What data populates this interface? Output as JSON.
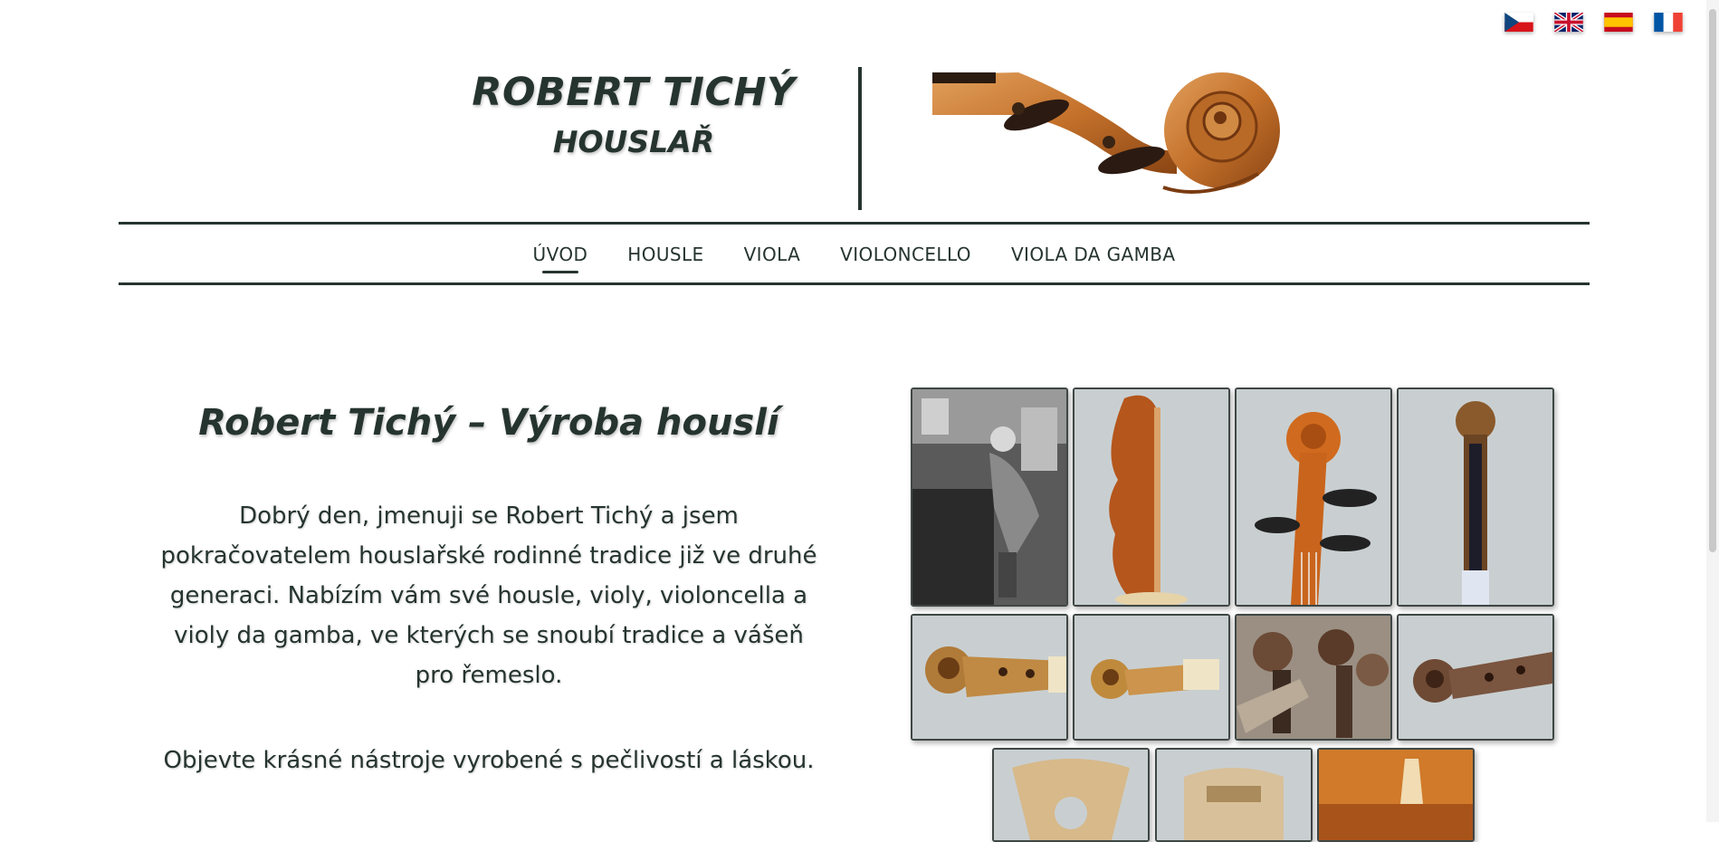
{
  "languages": [
    {
      "code": "cs",
      "icon": "czech-flag-icon"
    },
    {
      "code": "en",
      "icon": "uk-flag-icon"
    },
    {
      "code": "es",
      "icon": "spanish-flag-icon"
    },
    {
      "code": "fr",
      "icon": "french-flag-icon"
    }
  ],
  "header": {
    "title": "ROBERT TICHÝ",
    "subtitle": "HOUSLAŘ"
  },
  "nav": {
    "items": [
      {
        "label": "ÚVOD",
        "active": true
      },
      {
        "label": "HOUSLE",
        "active": false
      },
      {
        "label": "VIOLA",
        "active": false
      },
      {
        "label": "VIOLONCELLO",
        "active": false
      },
      {
        "label": "VIOLA DA GAMBA",
        "active": false
      }
    ]
  },
  "intro": {
    "heading": "Robert Tichý – Výroba houslí",
    "paragraph1": "Dobrý den, jmenuji se Robert Tichý a jsem pokračovatelem houslařské rodinné tradice již ve druhé generaci. Nabízím vám své housle, violy, violoncella a violy da gamba, ve kterých se snoubí tradice a vášeň pro řemeslo.",
    "paragraph2": "Objevte krásné nástroje vyrobené s pečlivostí a láskou."
  },
  "gallery": {
    "thumbnails": [
      "workshop-photo",
      "violin-side-photo",
      "violin-scroll-photo",
      "scroll-front-photo",
      "scroll-side-photo",
      "scroll-side-small-photo",
      "scrolls-pile-photo",
      "old-scroll-photo",
      "wooden-mold-photo",
      "body-mold-photo",
      "violin-bridge-photo"
    ]
  },
  "colors": {
    "text": "#263430",
    "accent_lines": "#263430",
    "wood": "#c7752c",
    "tile_bg": "#c9cfd1"
  }
}
